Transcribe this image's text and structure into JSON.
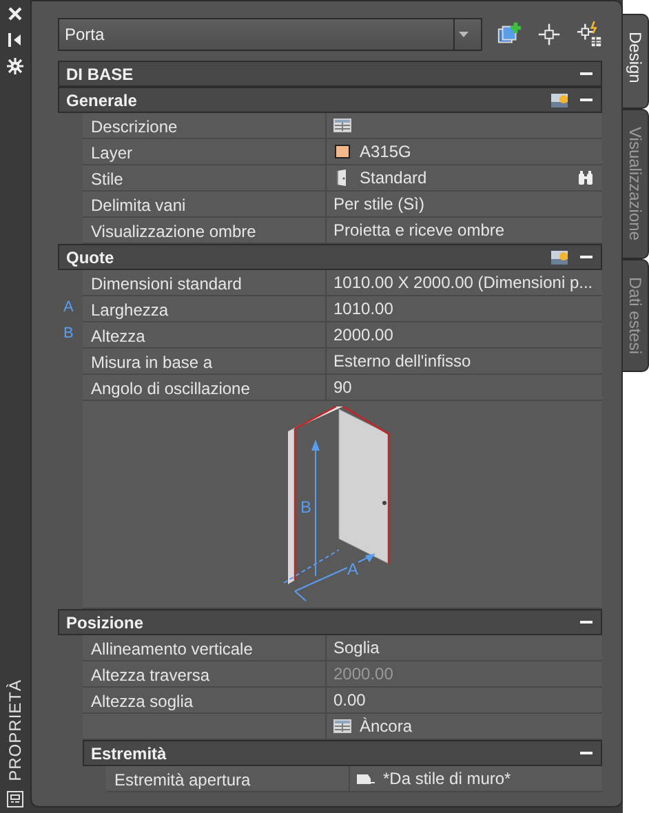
{
  "side_panel": {
    "title": "PROPRIETÀ"
  },
  "selector": {
    "value": "Porta"
  },
  "tabs": [
    {
      "label": "Design",
      "selected": true
    },
    {
      "label": "Visualizzazione",
      "selected": false
    },
    {
      "label": "Dati estesi",
      "selected": false
    }
  ],
  "category": {
    "title": "DI BASE",
    "expanded": true
  },
  "groups": [
    {
      "title": "Generale",
      "expanded": true,
      "style_icon": true,
      "properties": [
        {
          "label": "Descrizione",
          "kind": "table"
        },
        {
          "label": "Layer",
          "value": "A315G",
          "kind": "layer",
          "disabled": false
        },
        {
          "label": "Stile",
          "value": "Standard",
          "kind": "style",
          "disabled": false
        },
        {
          "label": "Delimita vani",
          "value": "Per stile (Sì)",
          "disabled": false
        },
        {
          "label": "Visualizzazione ombre",
          "value": "Proietta e riceve ombre",
          "disabled": false
        }
      ]
    },
    {
      "title": "Quote",
      "expanded": true,
      "style_icon": true,
      "properties": [
        {
          "label": "Dimensioni standard",
          "value": "1010.00  X  2000.00 (Dimensioni p...",
          "disabled": false
        },
        {
          "marker": "A",
          "label": "Larghezza",
          "value": "1010.00",
          "disabled": false
        },
        {
          "marker": "B",
          "label": "Altezza",
          "value": "2000.00",
          "disabled": false
        },
        {
          "label": "Misura in base a",
          "value": "Esterno dell'infisso",
          "disabled": false
        },
        {
          "label": "Angolo di oscillazione",
          "value": "90",
          "disabled": false
        }
      ],
      "diagram": {
        "height_label": "B",
        "width_label": "A"
      }
    },
    {
      "title": "Posizione",
      "expanded": true,
      "style_icon": false,
      "properties": [
        {
          "label": "Allineamento verticale",
          "value": "Soglia",
          "disabled": false
        },
        {
          "label": "Altezza traversa",
          "value": "2000.00",
          "disabled": true
        },
        {
          "label": "Altezza soglia",
          "value": "0.00",
          "disabled": false
        },
        {
          "value": "Àncora",
          "kind": "table",
          "disabled": false
        }
      ],
      "subgroups": [
        {
          "title": "Estremità",
          "expanded": true,
          "properties": [
            {
              "label": "Estremità apertura",
              "value": "*Da stile di muro*",
              "kind": "endcap",
              "disabled": false
            }
          ]
        }
      ]
    }
  ]
}
